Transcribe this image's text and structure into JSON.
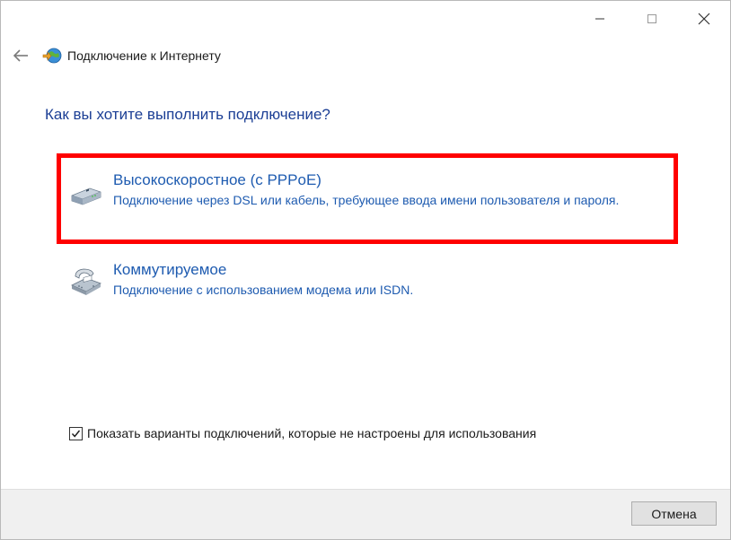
{
  "window": {
    "title": "Подключение к Интернету",
    "caption_buttons": [
      "minimize",
      "maximize",
      "close"
    ]
  },
  "main": {
    "heading": "Как вы хотите выполнить подключение?",
    "options": [
      {
        "title": "Высокоскоростное (с PPPoE)",
        "description": "Подключение через DSL или кабель, требующее ввода имени пользователя и пароля.",
        "icon": "modem-icon",
        "highlighted": true
      },
      {
        "title": "Коммутируемое",
        "description": "Подключение с использованием модема или ISDN.",
        "icon": "phone-icon",
        "highlighted": false
      }
    ],
    "checkbox": {
      "label": "Показать варианты подключений, которые не настроены для использования",
      "checked": true
    }
  },
  "footer": {
    "cancel_label": "Отмена"
  },
  "colors": {
    "heading": "#1c3f95",
    "link": "#1e5bb0",
    "highlight_border": "#ff0000",
    "footer_bg": "#f0f0f0"
  }
}
